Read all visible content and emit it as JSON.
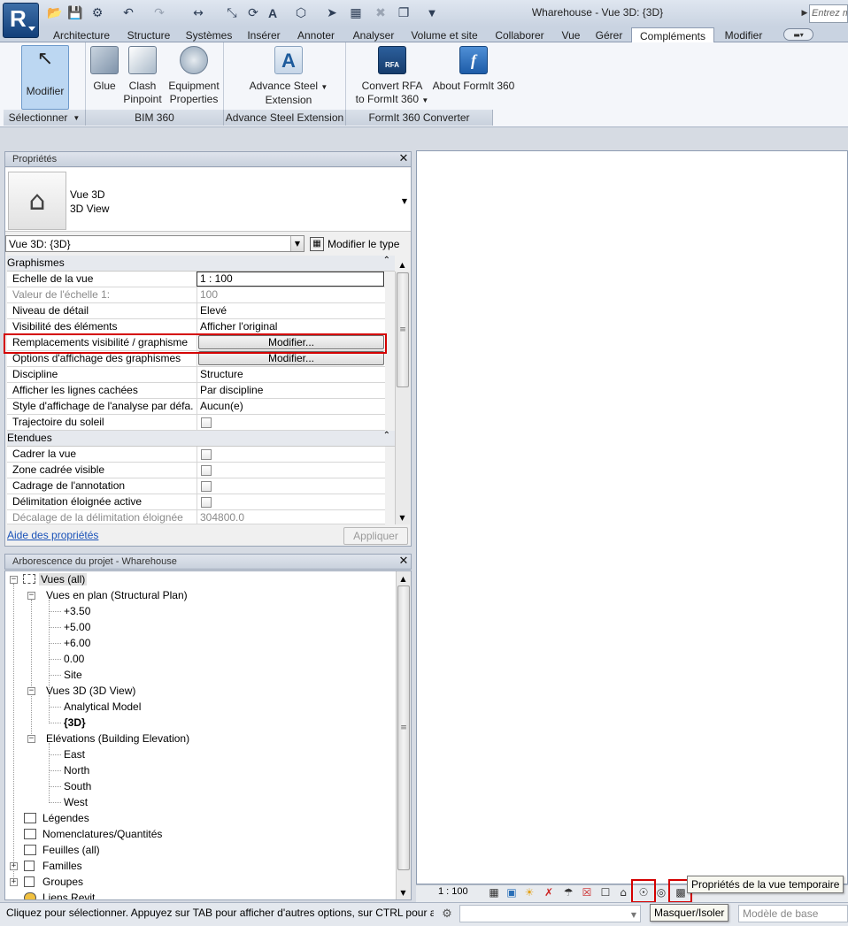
{
  "window": {
    "title": "Wharehouse - Vue 3D: {3D}",
    "search_placeholder": "Entrez m"
  },
  "tabs": [
    "Architecture",
    "Structure",
    "Systèmes",
    "Insérer",
    "Annoter",
    "Analyser",
    "Volume et site",
    "Collaborer",
    "Vue",
    "Gérer",
    "Compléments",
    "Modifier"
  ],
  "active_tab": "Compléments",
  "ribbon": {
    "modify": {
      "label": "Modifier",
      "panel": "Sélectionner"
    },
    "bim360": {
      "panel": "BIM 360",
      "glue": "Glue",
      "clash1": "Clash",
      "clash2": "Pinpoint",
      "equip1": "Equipment",
      "equip2": "Properties"
    },
    "steel": {
      "panel": "Advance Steel Extension",
      "l1": "Advance Steel",
      "l2": "Extension"
    },
    "formit": {
      "panel": "FormIt 360 Converter",
      "conv1": "Convert RFA",
      "conv2": "to FormIt 360",
      "about": "About FormIt 360",
      "rfa": "RFA"
    }
  },
  "properties": {
    "title": "Propriétés",
    "type_line1": "Vue 3D",
    "type_line2": "3D View",
    "selector": "Vue 3D: {3D}",
    "edit_type": "Modifier le type",
    "groups": {
      "graphics": "Graphismes",
      "extents": "Etendues"
    },
    "rows": [
      {
        "name": "Echelle de la vue",
        "value": "1 : 100"
      },
      {
        "name": "Valeur de l'échelle    1:",
        "value": "100"
      },
      {
        "name": "Niveau de détail",
        "value": "Elevé"
      },
      {
        "name": "Visibilité des éléments",
        "value": "Afficher l'original"
      },
      {
        "name": "Remplacements visibilité / graphisme",
        "value": "Modifier..."
      },
      {
        "name": "Options d'affichage des graphismes",
        "value": "Modifier..."
      },
      {
        "name": "Discipline",
        "value": "Structure"
      },
      {
        "name": "Afficher les lignes cachées",
        "value": "Par discipline"
      },
      {
        "name": "Style d'affichage de l'analyse par défa...",
        "value": "Aucun(e)"
      },
      {
        "name": "Trajectoire du soleil",
        "value": ""
      }
    ],
    "extent_rows": [
      {
        "name": "Cadrer la vue",
        "value": ""
      },
      {
        "name": "Zone cadrée visible",
        "value": ""
      },
      {
        "name": "Cadrage de l'annotation",
        "value": ""
      },
      {
        "name": "Délimitation éloignée active",
        "value": ""
      },
      {
        "name": "Décalage de la délimitation éloignée",
        "value": "304800.0"
      }
    ],
    "help_link": "Aide des propriétés",
    "apply": "Appliquer"
  },
  "browser": {
    "title": "Arborescence du projet - Wharehouse",
    "items": [
      {
        "label": "Vues (all)"
      },
      {
        "label": "Vues en plan (Structural Plan)"
      },
      {
        "label": "+3.50"
      },
      {
        "label": "+5.00"
      },
      {
        "label": "+6.00"
      },
      {
        "label": "0.00"
      },
      {
        "label": "Site"
      },
      {
        "label": "Vues 3D (3D View)"
      },
      {
        "label": "Analytical Model"
      },
      {
        "label": "{3D}"
      },
      {
        "label": "Elévations (Building Elevation)"
      },
      {
        "label": "East"
      },
      {
        "label": "North"
      },
      {
        "label": "South"
      },
      {
        "label": "West"
      },
      {
        "label": "Légendes"
      },
      {
        "label": "Nomenclatures/Quantités"
      },
      {
        "label": "Feuilles (all)"
      },
      {
        "label": "Familles"
      },
      {
        "label": "Groupes"
      },
      {
        "label": "Liens Revit"
      }
    ]
  },
  "viewbar": {
    "scale": "1 : 100"
  },
  "tooltips": {
    "temp_view": "Propriétés de la vue temporaire",
    "hide_isolate": "Masquer/Isoler"
  },
  "status": {
    "text": "Cliquez pour sélectionner. Appuyez sur TAB pour afficher d'autres options, sur CTRL pour aj",
    "model": "Modèle de base"
  },
  "colors": {
    "highlight": "#d40000",
    "tab_active_bg": "#ffffff",
    "modify_btn": "#bcd7f2"
  }
}
